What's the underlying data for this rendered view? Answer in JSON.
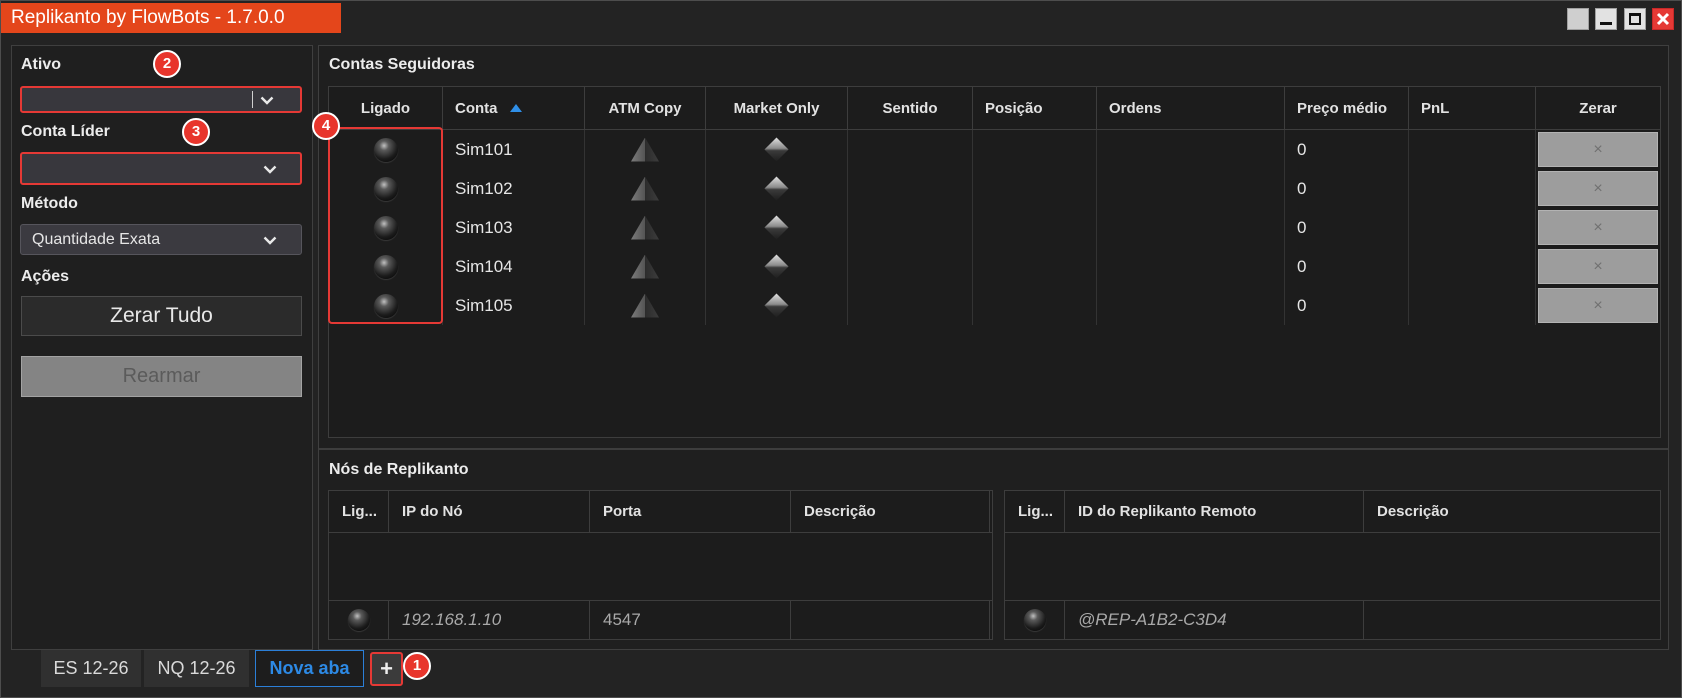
{
  "window": {
    "title": "Replikanto by FlowBots - 1.7.0.0",
    "title_color": "#e4461b",
    "controls": {
      "menu_icon": "window-menu-icon",
      "minimize_icon": "minimize-icon",
      "maximize_icon": "maximize-icon",
      "close_icon": "close-icon",
      "close_color": "#e53935"
    }
  },
  "annotations": {
    "add_tab": "1",
    "ativo": "2",
    "conta_lider": "3",
    "ligado_column": "4",
    "color": "#e53935"
  },
  "sidebar": {
    "ativo": {
      "label": "Ativo",
      "value": "",
      "icon": "chevron-down-icon"
    },
    "conta_lider": {
      "label": "Conta Líder",
      "value": "",
      "icon": "chevron-down-icon"
    },
    "metodo": {
      "label": "Método",
      "value": "Quantidade Exata",
      "icon": "chevron-down-icon"
    },
    "acoes": {
      "label": "Ações",
      "zerar_tudo": "Zerar Tudo",
      "rearmar": "Rearmar",
      "rearmar_enabled": false
    }
  },
  "followers": {
    "title": "Contas Seguidoras",
    "columns": [
      "Ligado",
      "Conta",
      "ATM Copy",
      "Market Only",
      "Sentido",
      "Posição",
      "Ordens",
      "Preço médio",
      "PnL",
      "Zerar"
    ],
    "sort": {
      "column_index": 1,
      "ascending": true,
      "icon": "sort-ascending-icon",
      "color": "#2f8fe8"
    },
    "zerar_glyph": "×",
    "rows": [
      {
        "conta": "Sim101",
        "preco_medio": "0",
        "ligado_icon": "led-off-icon",
        "atm_copy_icon": "triangle-icon",
        "market_only_icon": "diamond-icon"
      },
      {
        "conta": "Sim102",
        "preco_medio": "0",
        "ligado_icon": "led-off-icon",
        "atm_copy_icon": "triangle-icon",
        "market_only_icon": "diamond-icon"
      },
      {
        "conta": "Sim103",
        "preco_medio": "0",
        "ligado_icon": "led-off-icon",
        "atm_copy_icon": "triangle-icon",
        "market_only_icon": "diamond-icon"
      },
      {
        "conta": "Sim104",
        "preco_medio": "0",
        "ligado_icon": "led-off-icon",
        "atm_copy_icon": "triangle-icon",
        "market_only_icon": "diamond-icon"
      },
      {
        "conta": "Sim105",
        "preco_medio": "0",
        "ligado_icon": "led-off-icon",
        "atm_copy_icon": "triangle-icon",
        "market_only_icon": "diamond-icon"
      }
    ]
  },
  "nodes": {
    "title": "Nós de Replikanto",
    "local": {
      "columns": [
        "Lig...",
        "IP do Nó",
        "Porta",
        "Descrição"
      ],
      "rows": [
        {
          "ligado_icon": "led-off-icon",
          "ip": "192.168.1.10",
          "porta": "4547"
        }
      ]
    },
    "remote": {
      "columns": [
        "Lig...",
        "ID do Replikanto Remoto",
        "Descrição"
      ],
      "rows": [
        {
          "ligado_icon": "led-off-icon",
          "id": "@REP-A1B2-C3D4"
        }
      ]
    }
  },
  "tabs": {
    "items": [
      {
        "label": "ES 12-26",
        "active": false
      },
      {
        "label": "NQ 12-26",
        "active": false
      },
      {
        "label": "Nova aba",
        "active": true
      }
    ],
    "add_label": "+",
    "active_color": "#2d8ae5"
  }
}
